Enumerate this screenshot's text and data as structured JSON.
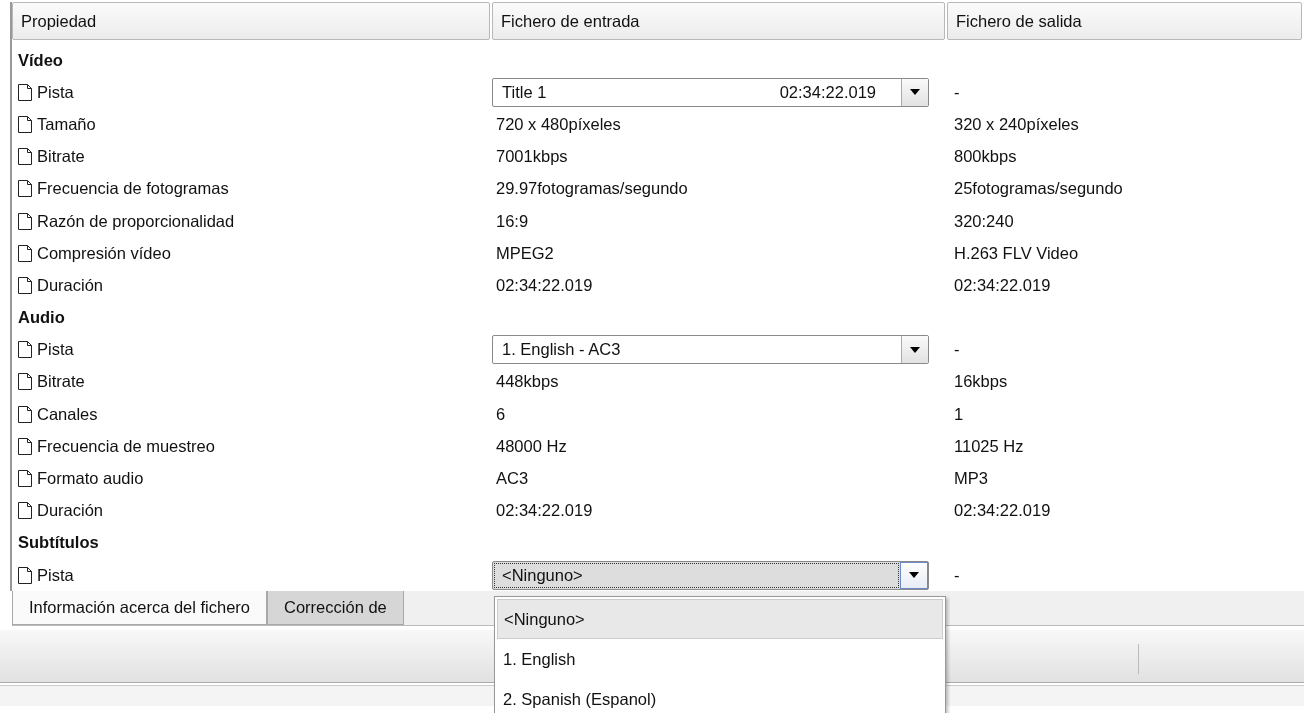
{
  "columns": [
    "Propiedad",
    "Fichero de entrada",
    "Fichero de salida"
  ],
  "sections": [
    {
      "title": "Vídeo",
      "rows": [
        {
          "kind": "select",
          "property": "Pista",
          "input": {
            "value": "Title 1",
            "detail": "02:34:22.019",
            "focused": false
          },
          "output": "-"
        },
        {
          "kind": "text",
          "property": "Tamaño",
          "input": "720 x 480píxeles",
          "output": "320 x 240píxeles"
        },
        {
          "kind": "text",
          "property": "Bitrate",
          "input": "7001kbps",
          "output": "800kbps"
        },
        {
          "kind": "text",
          "property": "Frecuencia de fotogramas",
          "input": "29.97fotogramas/segundo",
          "output": "25fotogramas/segundo"
        },
        {
          "kind": "text",
          "property": "Razón de proporcionalidad",
          "input": "16:9",
          "output": "320:240"
        },
        {
          "kind": "text",
          "property": "Compresión vídeo",
          "input": "MPEG2",
          "output": "H.263 FLV Video"
        },
        {
          "kind": "text",
          "property": "Duración",
          "input": "02:34:22.019",
          "output": "02:34:22.019"
        }
      ]
    },
    {
      "title": "Audio",
      "rows": [
        {
          "kind": "select",
          "property": "Pista",
          "input": {
            "value": "1. English - AC3",
            "focused": false
          },
          "output": "-"
        },
        {
          "kind": "text",
          "property": "Bitrate",
          "input": "448kbps",
          "output": "16kbps"
        },
        {
          "kind": "text",
          "property": "Canales",
          "input": "6",
          "output": "1"
        },
        {
          "kind": "text",
          "property": "Frecuencia de muestreo",
          "input": "48000 Hz",
          "output": "11025 Hz"
        },
        {
          "kind": "text",
          "property": "Formato audio",
          "input": "AC3",
          "output": "MP3"
        },
        {
          "kind": "text",
          "property": "Duración",
          "input": "02:34:22.019",
          "output": "02:34:22.019"
        }
      ]
    },
    {
      "title": "Subtítulos",
      "rows": [
        {
          "kind": "select",
          "property": "Pista",
          "input": {
            "value": "<Ninguno>",
            "focused": true
          },
          "output": "-"
        }
      ]
    }
  ],
  "tabs": [
    {
      "label": "Información acerca del fichero",
      "selected": true
    },
    {
      "label": "Corrección de",
      "selected": false
    }
  ],
  "dropdown": {
    "options": [
      {
        "label": "<Ninguno>",
        "selected": true
      },
      {
        "label": "1. English",
        "selected": false
      },
      {
        "label": "2. Spanish (Espanol)",
        "selected": false
      }
    ]
  }
}
